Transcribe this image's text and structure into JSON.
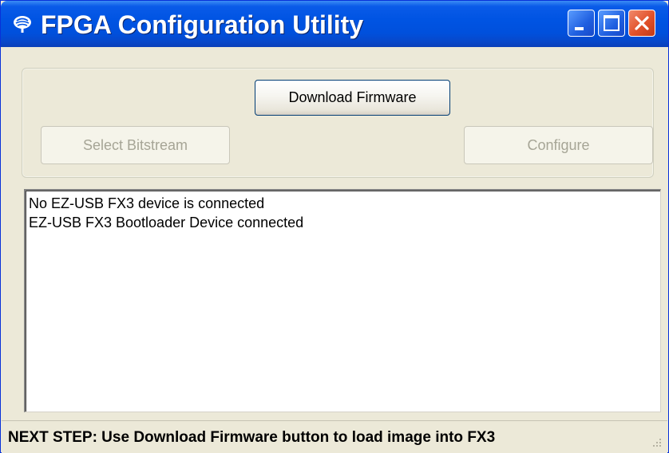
{
  "window": {
    "title": "FPGA Configuration Utility",
    "icon": "cypress-tree-icon",
    "controls": [
      "minimize-icon",
      "maximize-icon",
      "close-icon"
    ]
  },
  "buttons": {
    "download_firmware": "Download Firmware",
    "select_bitstream": "Select Bitstream",
    "configure": "Configure"
  },
  "log": {
    "lines": [
      "No EZ-USB  FX3 device is connected",
      "EZ-USB FX3 Bootloader Device connected"
    ]
  },
  "status": {
    "text": "NEXT STEP: Use Download Firmware button to load image into FX3"
  },
  "colors": {
    "titlebar": "#0054e3",
    "window_bg": "#ece9d8",
    "close_button": "#e2512a",
    "disabled_text": "#a6a596"
  }
}
